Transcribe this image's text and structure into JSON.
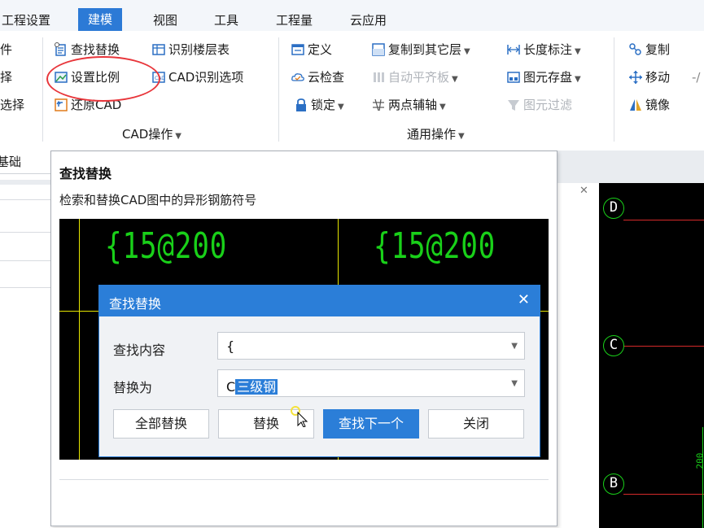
{
  "menubar": {
    "items": [
      "工程设置",
      "建模",
      "视图",
      "工具",
      "工程量",
      "云应用"
    ],
    "active_index": 1
  },
  "ribbon": {
    "left_partial": [
      "件",
      "择",
      "选择"
    ],
    "cad_group": {
      "find_replace": "查找替换",
      "identify_floor_table": "识别楼层表",
      "set_scale": "设置比例",
      "cad_identify_options": "CAD识别选项",
      "restore_cad": "还原CAD",
      "label": "CAD操作"
    },
    "general_group": {
      "define": "定义",
      "copy_to_other_floor": "复制到其它层",
      "length_dimension": "长度标注",
      "cloud_check": "云检查",
      "auto_flat_slab": "自动平齐板",
      "element_save": "图元存盘",
      "lock": "锁定",
      "two_point_axis": "两点辅轴",
      "element_filter": "图元过滤",
      "label": "通用操作"
    },
    "edit_group": {
      "copy": "复制",
      "move": "移动",
      "mirror": "镜像"
    }
  },
  "left_panel": {
    "tab": "基础"
  },
  "tooltip": {
    "title": "查找替换",
    "description": "检索和替换CAD图中的异形钢筋符号",
    "cad_texts": [
      "{15@200",
      "{15@200"
    ],
    "dialog": {
      "title": "查找替换",
      "find_label": "查找内容",
      "find_value": "{",
      "replace_label": "替换为",
      "replace_value_prefix": "C",
      "replace_value_selected": "三级钢",
      "buttons": [
        "全部替换",
        "替换",
        "查找下一个",
        "关闭"
      ]
    }
  },
  "canvas": {
    "axis_labels": [
      "D",
      "C",
      "B"
    ],
    "dimension_text": "200"
  },
  "colors": {
    "accent": "#2b7ed8",
    "highlight_circle": "#e8363b",
    "cad_green": "#19d019",
    "cad_yellow": "#e6e600",
    "axis_red": "#d42a2a"
  }
}
